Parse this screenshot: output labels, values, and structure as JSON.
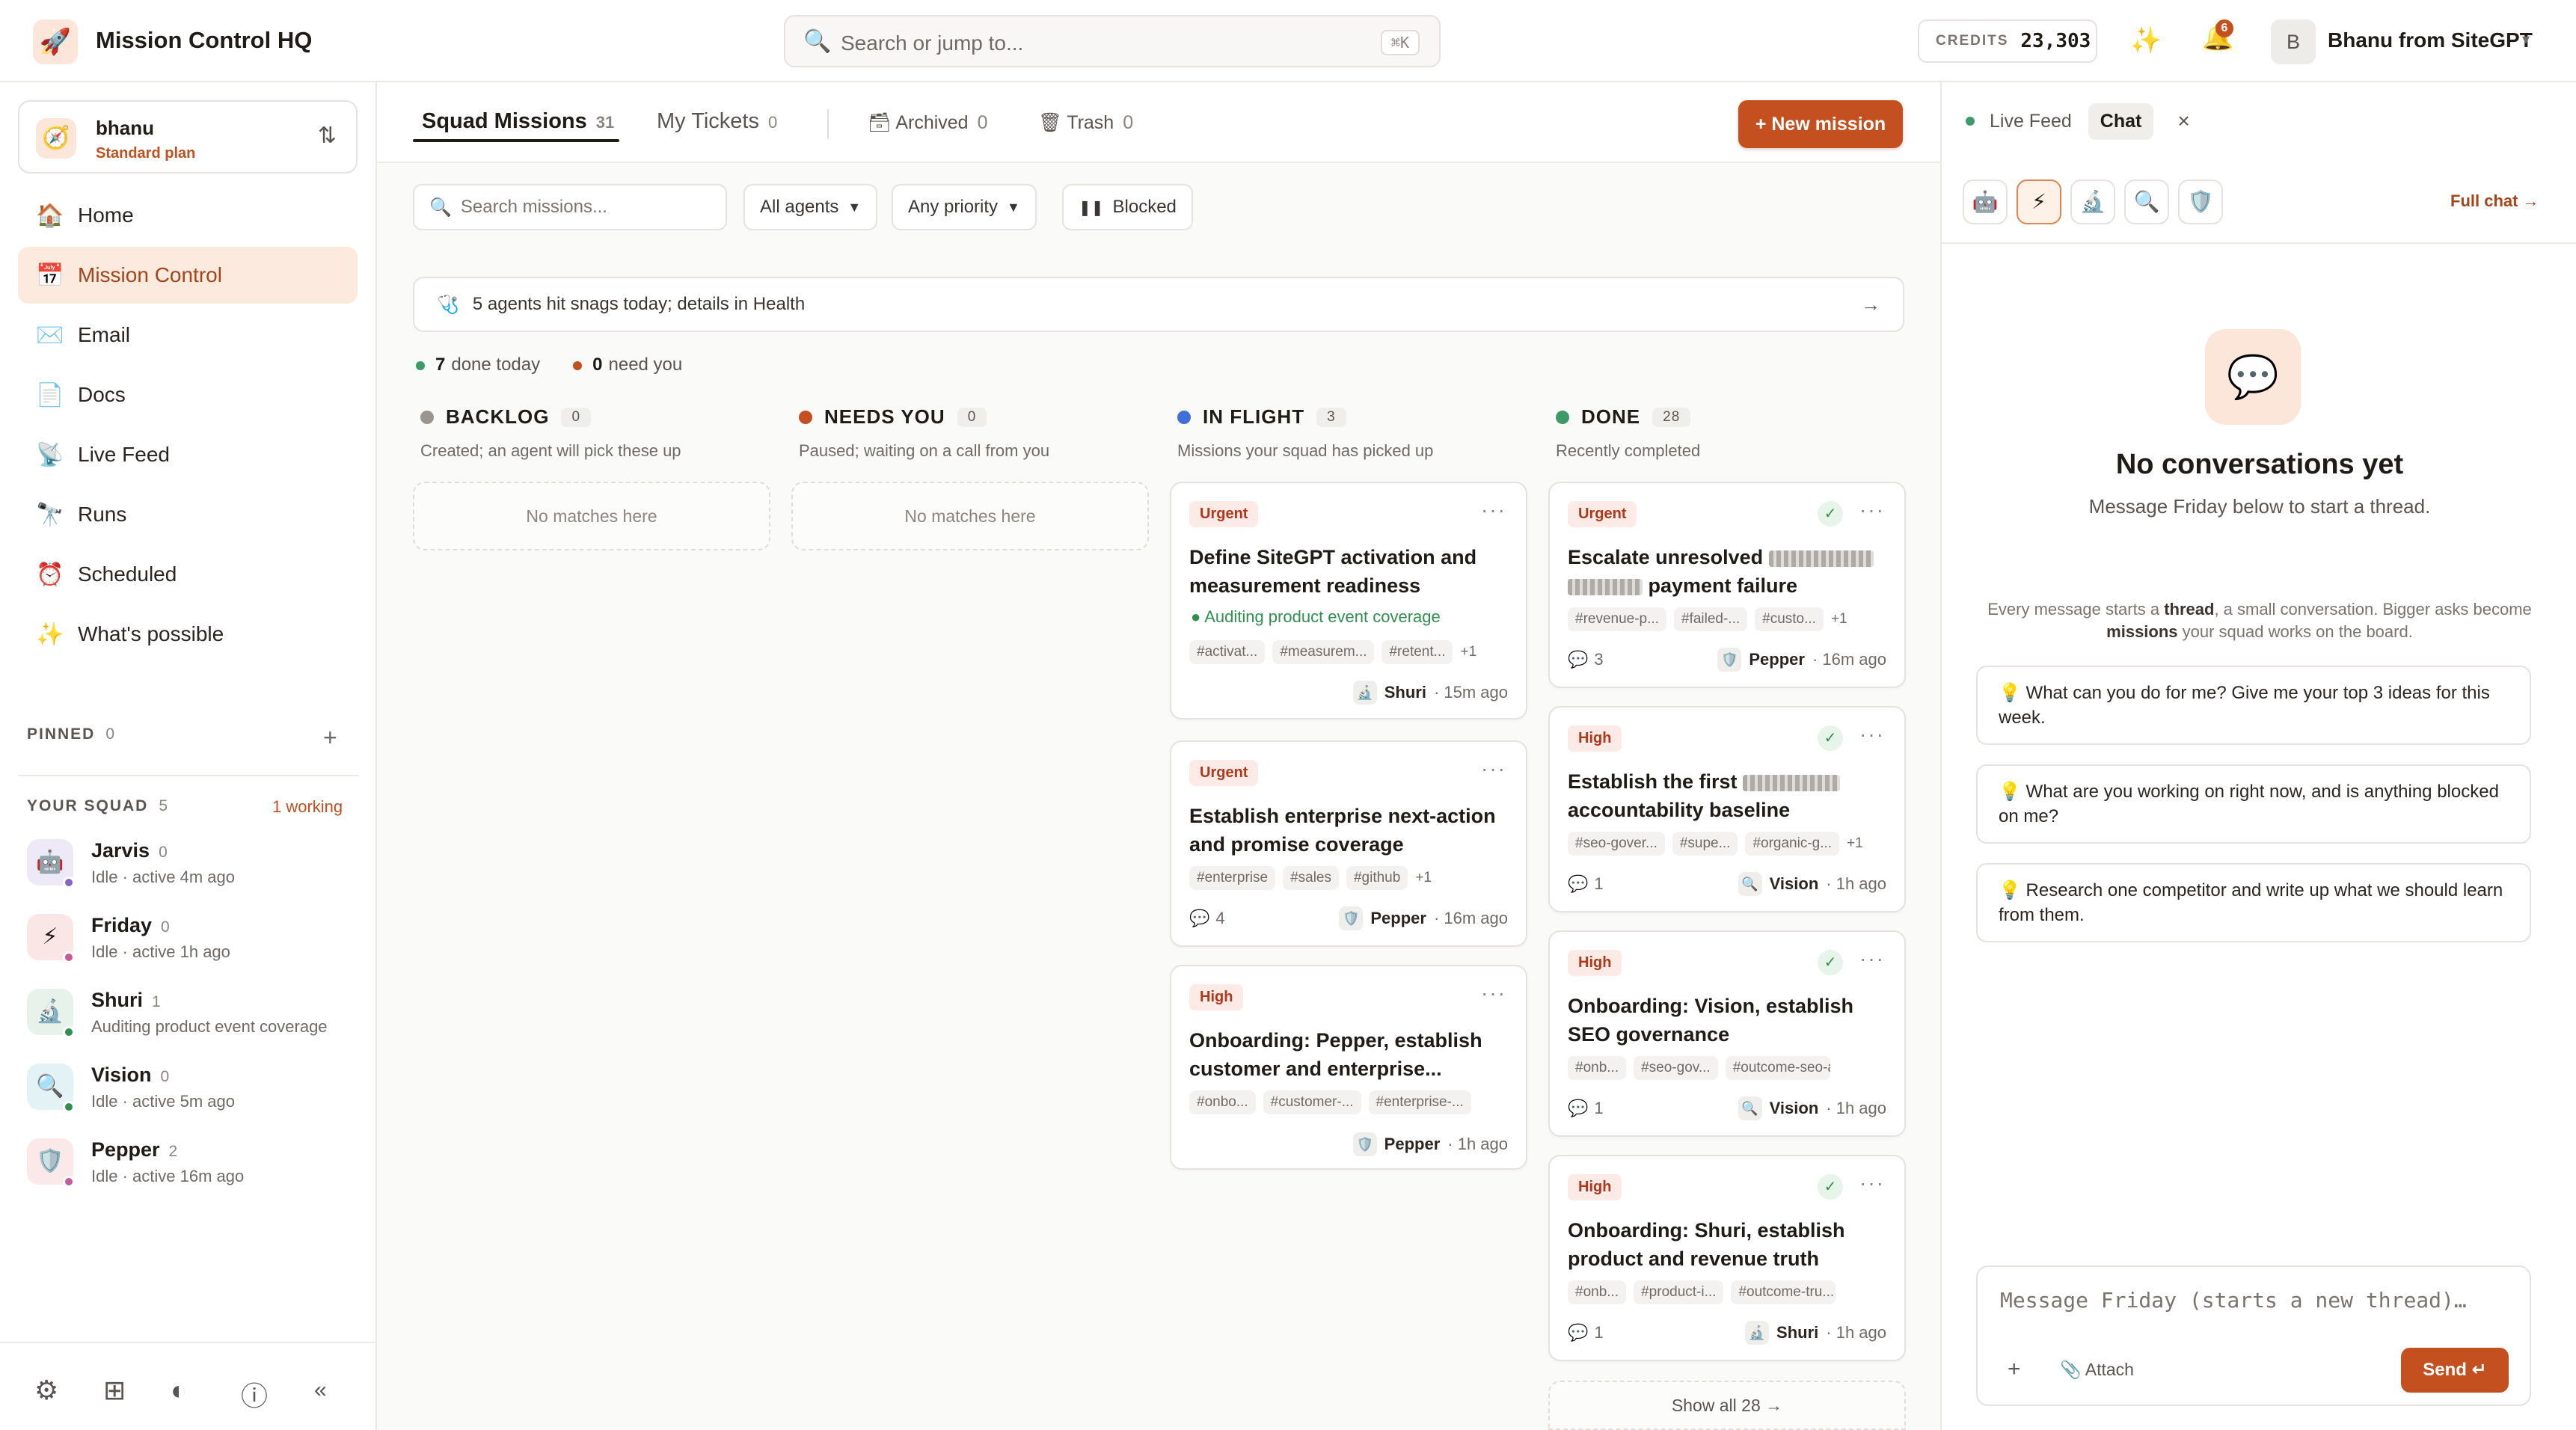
{
  "app": {
    "title": "Mission Control HQ",
    "logo_icon": "🚀"
  },
  "search": {
    "placeholder": "Search or jump to...",
    "shortcut": "⌘K"
  },
  "credits": {
    "label": "CREDITS",
    "value": "23,303"
  },
  "notifications": {
    "count": "6"
  },
  "user": {
    "avatar": "B",
    "name": "Bhanu from SiteGPT"
  },
  "account": {
    "name": "bhanu",
    "plan": "Standard plan",
    "icon": "🧭"
  },
  "nav": [
    {
      "label": "Home",
      "icon": "🏠"
    },
    {
      "label": "Mission Control",
      "icon": "📅",
      "active": true
    },
    {
      "label": "Email",
      "icon": "✉️"
    },
    {
      "label": "Docs",
      "icon": "📄"
    },
    {
      "label": "Live Feed",
      "icon": "📡"
    },
    {
      "label": "Runs",
      "icon": "🔭"
    },
    {
      "label": "Scheduled",
      "icon": "⏰"
    },
    {
      "label": "What's possible",
      "icon": "✨"
    }
  ],
  "pinned": {
    "title": "PINNED",
    "count": "0"
  },
  "squad": {
    "title": "YOUR SQUAD",
    "count": "5",
    "working": "1 working",
    "agents": [
      {
        "name": "Jarvis",
        "count": "0",
        "status": "Idle · active 4m ago",
        "icon": "🤖",
        "bg": "#ede9f7",
        "dot": "#8a63c9"
      },
      {
        "name": "Friday",
        "count": "0",
        "status": "Idle · active 1h ago",
        "icon": "⚡",
        "bg": "#fbe6e6",
        "dot": "#c95a9a"
      },
      {
        "name": "Shuri",
        "count": "1",
        "status": "Auditing product event coverage",
        "icon": "🔬",
        "bg": "#e6f2ea",
        "dot": "#2f8f4e"
      },
      {
        "name": "Vision",
        "count": "0",
        "status": "Idle · active 5m ago",
        "icon": "🔍",
        "bg": "#e3f2f4",
        "dot": "#2f8f4e"
      },
      {
        "name": "Pepper",
        "count": "2",
        "status": "Idle · active 16m ago",
        "icon": "🛡️",
        "bg": "#fbe8e8",
        "dot": "#c95a9a"
      }
    ]
  },
  "tabs": {
    "squad": {
      "label": "Squad Missions",
      "count": "31"
    },
    "tickets": {
      "label": "My Tickets",
      "count": "0"
    },
    "archived": {
      "label": "Archived",
      "count": "0"
    },
    "trash": {
      "label": "Trash",
      "count": "0"
    }
  },
  "new_mission": "+ New mission",
  "filters": {
    "search_placeholder": "Search missions...",
    "agents": "All agents",
    "priority": "Any priority",
    "blocked": "Blocked"
  },
  "snag": "5 agents hit snags today; details in Health",
  "stats": {
    "done": "7",
    "done_label": "done today",
    "need": "0",
    "need_label": "need you"
  },
  "columns": [
    {
      "title": "BACKLOG",
      "count": "0",
      "sub": "Created; an agent will pick these up",
      "empty": "No matches here",
      "color": "#9a9590"
    },
    {
      "title": "NEEDS YOU",
      "count": "0",
      "sub": "Paused; waiting on a call from you",
      "empty": "No matches here",
      "color": "#c4501f"
    },
    {
      "title": "IN FLIGHT",
      "count": "3",
      "sub": "Missions your squad has picked up",
      "color": "#3f6fd8"
    },
    {
      "title": "DONE",
      "count": "28",
      "sub": "Recently completed",
      "color": "#3f9a6a"
    }
  ],
  "inflight": [
    {
      "priority": "Urgent",
      "title": "Define SiteGPT activation and measurement readiness",
      "activity": "Auditing product event coverage",
      "tags": [
        "#activat...",
        "#measurem...",
        "#retent..."
      ],
      "more": "+1",
      "agent": "Shuri",
      "agent_icon": "🔬",
      "time": "· 15m ago"
    },
    {
      "priority": "Urgent",
      "title": "Establish enterprise next-action and promise coverage",
      "tags": [
        "#enterprise",
        "#sales",
        "#github"
      ],
      "more": "+1",
      "comments": "4",
      "agent": "Pepper",
      "agent_icon": "🛡️",
      "time": "· 16m ago"
    },
    {
      "priority": "High",
      "title": "Onboarding: Pepper, establish customer and enterprise...",
      "tags": [
        "#onbo...",
        "#customer-...",
        "#enterprise-..."
      ],
      "agent": "Pepper",
      "agent_icon": "🛡️",
      "time": "· 1h ago"
    }
  ],
  "done": [
    {
      "priority": "Urgent",
      "title_a": "Escalate unresolved ",
      "title_b": " payment failure",
      "tags": [
        "#revenue-p...",
        "#failed-...",
        "#custo..."
      ],
      "more": "+1",
      "comments": "3",
      "agent": "Pepper",
      "agent_icon": "🛡️",
      "time": "· 16m ago"
    },
    {
      "priority": "High",
      "title_a": "Establish the first ",
      "title_b": "accountability baseline",
      "tags": [
        "#seo-gover...",
        "#supe...",
        "#organic-g..."
      ],
      "more": "+1",
      "comments": "1",
      "agent": "Vision",
      "agent_icon": "🔍",
      "time": "· 1h ago"
    },
    {
      "priority": "High",
      "title": "Onboarding: Vision, establish SEO governance",
      "tags": [
        "#onb...",
        "#seo-gov...",
        "#outcome-seo-a..."
      ],
      "comments": "1",
      "agent": "Vision",
      "agent_icon": "🔍",
      "time": "· 1h ago"
    },
    {
      "priority": "High",
      "title": "Onboarding: Shuri, establish product and revenue truth",
      "tags": [
        "#onb...",
        "#product-i...",
        "#outcome-tru..."
      ],
      "comments": "1",
      "agent": "Shuri",
      "agent_icon": "🔬",
      "time": "· 1h ago"
    }
  ],
  "show_all": "Show all 28 →",
  "right": {
    "live_feed": "Live Feed",
    "chat": "Chat",
    "full_chat": "Full chat →",
    "agent_icons": [
      "🤖",
      "⚡",
      "🔬",
      "🔍",
      "🛡️"
    ],
    "empty_title": "No conversations yet",
    "empty_sub": "Message Friday below to start a thread.",
    "info_a": "Every message starts a ",
    "info_b": "thread",
    "info_c": ", a small conversation. Bigger asks become ",
    "info_d": "missions",
    "info_e": " your squad works on the board.",
    "suggestions": [
      "💡 What can you do for me? Give me your top 3 ideas for this week.",
      "💡 What are you working on right now, and is anything blocked on me?",
      "💡 Research one competitor and write up what we should learn from them."
    ],
    "composer_placeholder": "Message Friday (starts a new thread)…",
    "attach": "Attach",
    "send": "Send ↵"
  }
}
